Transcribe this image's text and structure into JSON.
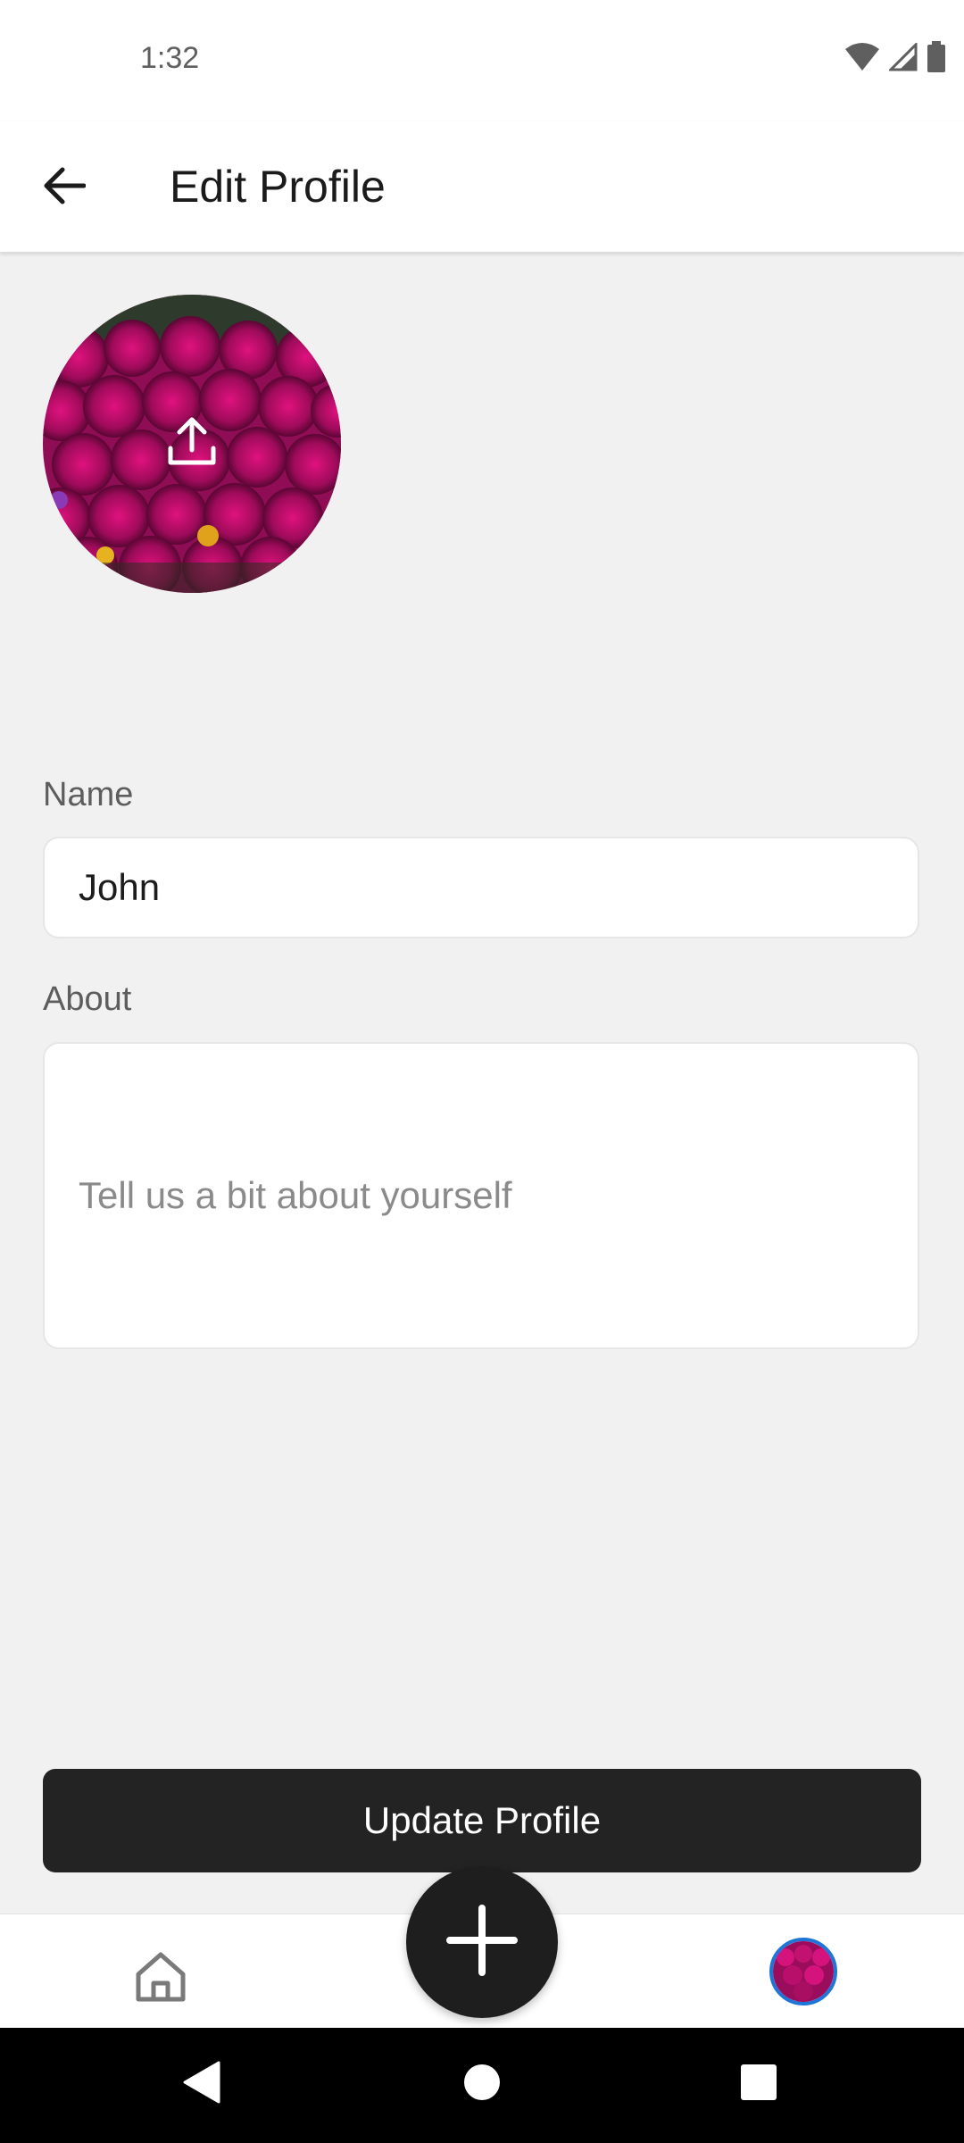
{
  "status_bar": {
    "time": "1:32",
    "icons": [
      "wifi-icon",
      "signal-icon",
      "battery-icon"
    ]
  },
  "header": {
    "title": "Edit Profile",
    "back_icon": "arrow-left-icon"
  },
  "avatar": {
    "image": "magenta flower field photo",
    "overlay_icon": "upload-icon"
  },
  "form": {
    "name_label": "Name",
    "name_value": "John",
    "about_label": "About",
    "about_placeholder": "Tell us a bit about yourself",
    "about_value": ""
  },
  "actions": {
    "update_label": "Update Profile"
  },
  "bottom_nav": {
    "home_icon": "home-icon",
    "fab_icon": "plus-icon",
    "profile_icon": "avatar-icon"
  },
  "system_nav": {
    "back_icon": "triangle-back-icon",
    "home_icon": "circle-home-icon",
    "recents_icon": "square-recents-icon"
  },
  "colors": {
    "background": "#f1f1f1",
    "surface": "#ffffff",
    "primary_dark": "#232323",
    "profile_ring": "#1f74d8"
  }
}
